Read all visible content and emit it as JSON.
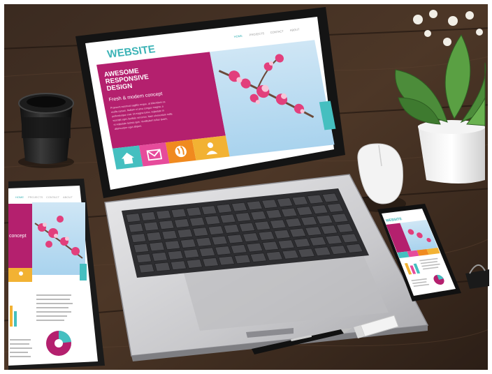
{
  "laptop_site": {
    "brand": "WEBSITE",
    "nav": [
      "HOME",
      "PROJECTS",
      "CONTACT",
      "ABOUT"
    ],
    "headline": [
      "AWESOME",
      "RESPONSIVE",
      "DESIGN"
    ],
    "tagline": "Fresh & modern concept",
    "body": [
      "Praesent euismod sagittis neque, at bibendum ex",
      "mollis cursus. Nullam et arcu congue magna, a",
      "pellentesque erat. Ut magna tortor, vulputate in",
      "suscipit eget, facilisis vel tortor. Nam elementum nulla",
      "et vulputate lacinia quis. Vestibulum tellus quam,",
      "ullamcorper eget aliquet."
    ],
    "icons": [
      "home-icon",
      "mail-icon",
      "globe-icon",
      "user-icon"
    ]
  },
  "tablet_site": {
    "nav": [
      "HOME",
      "PROJECTS",
      "CONTACT",
      "ABOUT"
    ],
    "tagline_fragment": "concept"
  },
  "phone_site": {
    "brand": "WEBSITE"
  },
  "colors": {
    "magenta": "#b4206e",
    "teal": "#45bfc0",
    "yellow": "#f2b233",
    "pink": "#e64b9b",
    "orange": "#f08a1f",
    "wood_dark": "#2a1d16",
    "wood_mid": "#4a3426"
  }
}
